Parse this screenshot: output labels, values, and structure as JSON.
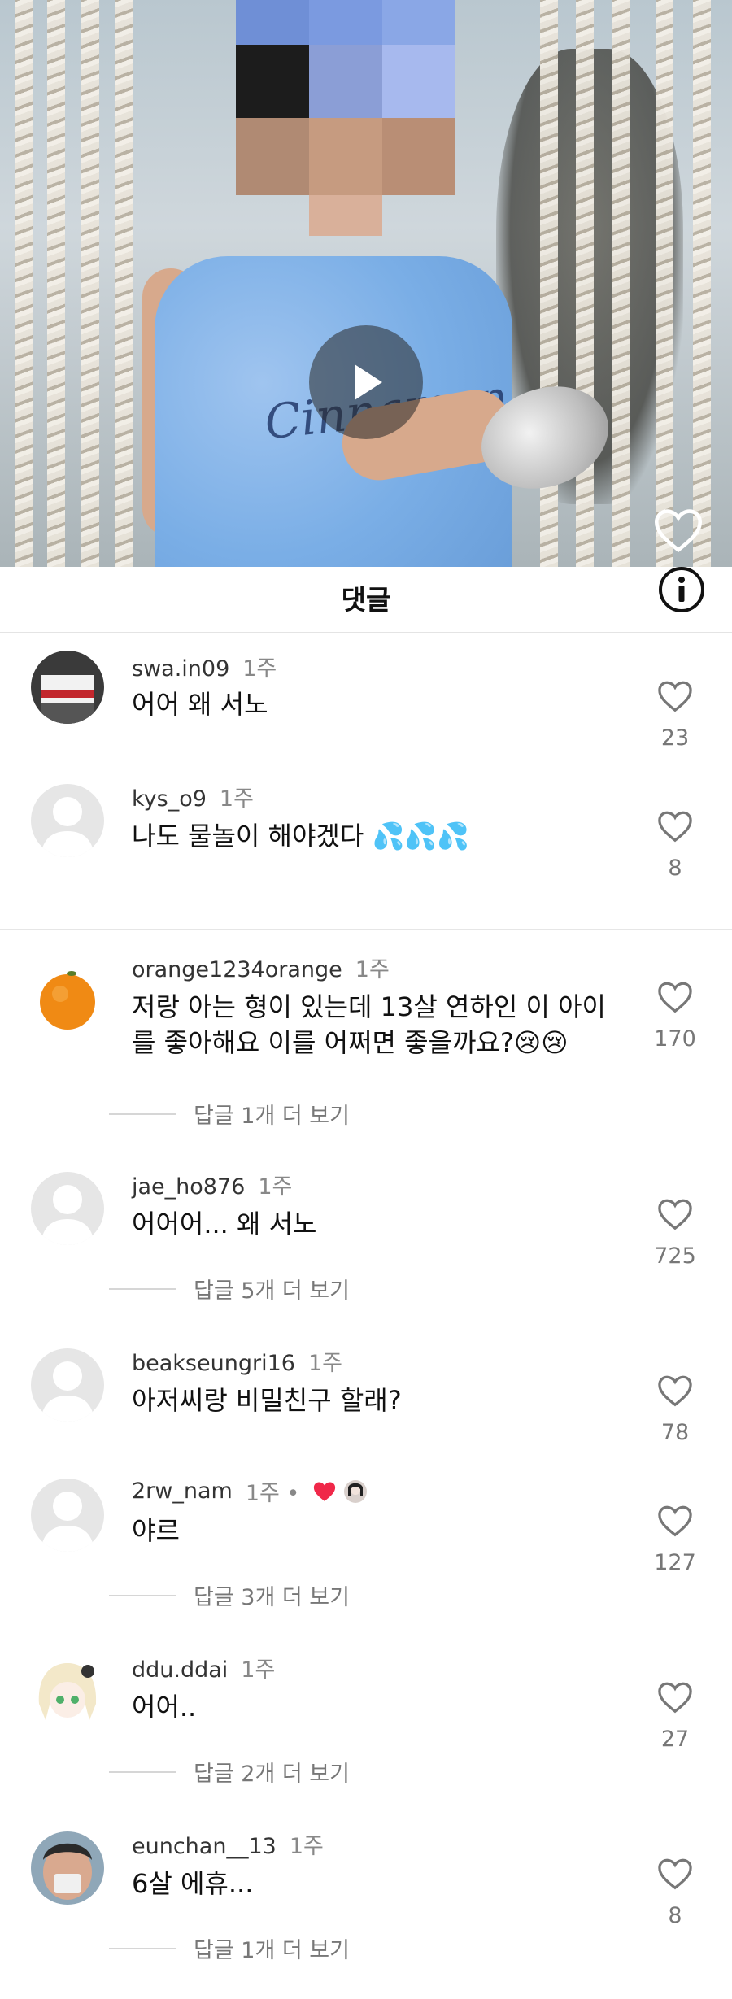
{
  "video": {
    "play_icon": "play-icon",
    "like_icon": "heart-outline-icon"
  },
  "header": {
    "title": "댓글",
    "info_icon": "info-icon"
  },
  "comments": [
    {
      "username": "swa.in09",
      "time": "1주",
      "text": "어어 왜 서노",
      "likes": "23",
      "replies": ""
    },
    {
      "username": "kys_o9",
      "time": "1주",
      "text": "나도 물놀이 해야겠다 💦💦💦",
      "likes": "8",
      "replies": ""
    },
    {
      "username": "orange1234orange",
      "time": "1주",
      "text": "저랑 아는 형이 있는데 13살 연하인 이 아이를 좋아해요 이를 어쩌면 좋을까요?😢😢",
      "likes": "170",
      "replies": "답글 1개 더 보기"
    },
    {
      "username": "jae_ho876",
      "time": "1주",
      "text": "어어어... 왜 서노",
      "likes": "725",
      "replies": "답글 5개 더 보기"
    },
    {
      "username": "beakseungri16",
      "time": "1주",
      "text": "아저씨랑 비밀친구 할래?",
      "likes": "78",
      "replies": ""
    },
    {
      "username": "2rw_nam",
      "time": "1주 •",
      "text": "야르",
      "likes": "127",
      "replies": "답글 3개 더 보기",
      "liked_by_creator": "red-heart-with-creator-avatar"
    },
    {
      "username": "ddu.ddai",
      "time": "1주",
      "text": "어어..",
      "likes": "27",
      "replies": "답글 2개 더 보기"
    },
    {
      "username": "eunchan__13",
      "time": "1주",
      "text": "6살 에휴...",
      "likes": "8",
      "replies": "답글 1개 더 보기"
    }
  ],
  "colors": {
    "heart_red": "#f02849",
    "muted_text": "#777777",
    "divider": "#e6e6e6"
  }
}
